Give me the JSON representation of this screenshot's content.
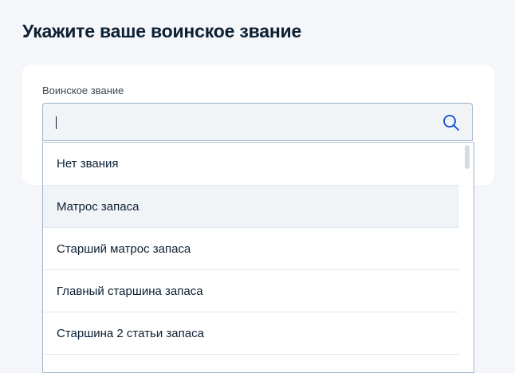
{
  "page": {
    "title": "Укажите ваше воинское звание"
  },
  "field": {
    "label": "Воинское звание",
    "value": ""
  },
  "dropdown": {
    "options": [
      {
        "label": "Нет звания"
      },
      {
        "label": "Матрос запаса",
        "hovered": true
      },
      {
        "label": "Старший матрос запаса"
      },
      {
        "label": "Главный старшина запаса"
      },
      {
        "label": "Старшина 2 статьи запаса"
      }
    ]
  },
  "icons": {
    "search": "search-icon"
  },
  "colors": {
    "background": "#f4f6fa",
    "card": "#ffffff",
    "input_border": "#9fb3cf",
    "input_fill": "#f1f4f7",
    "search_icon": "#0d4cd3",
    "text": "#0b1f33"
  }
}
